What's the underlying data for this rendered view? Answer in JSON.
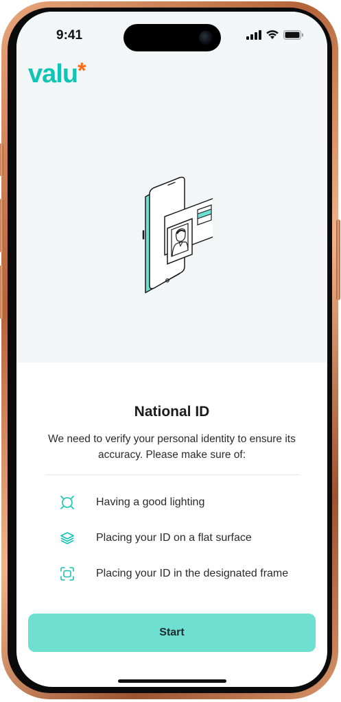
{
  "status_bar": {
    "time": "9:41"
  },
  "brand": {
    "logo_text": "valu",
    "logo_star": "*",
    "accent": "#11c4b4",
    "star_color": "#ff6a13"
  },
  "content": {
    "title": "National ID",
    "description": "We need to verify your personal identity to ensure its accuracy. Please make sure of:",
    "tips": [
      {
        "icon": "lighting-icon",
        "label": "Having a good lighting"
      },
      {
        "icon": "layers-icon",
        "label": "Placing your ID on a flat surface"
      },
      {
        "icon": "frame-scan-icon",
        "label": "Placing your ID in the designated frame"
      }
    ]
  },
  "actions": {
    "start_label": "Start",
    "button_color": "#6fdfd2"
  }
}
